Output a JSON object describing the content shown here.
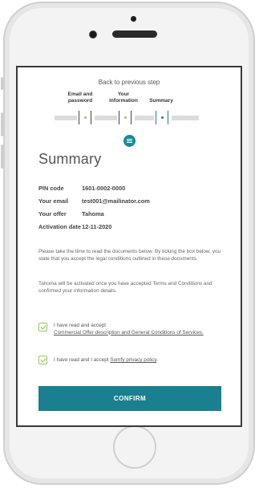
{
  "nav": {
    "back_label": "Back to previous step"
  },
  "steps": [
    {
      "line1": "Email and",
      "line2": "password",
      "status": "completed"
    },
    {
      "line1": "Your",
      "line2": "information",
      "status": "completed"
    },
    {
      "line1": "Summary",
      "line2": "",
      "status": "current"
    }
  ],
  "page": {
    "title": "Summary"
  },
  "summary": {
    "rows": [
      {
        "label": "PIN code",
        "value": "1601-0002-0000"
      },
      {
        "label": "Your email",
        "value": "test001@mailinator.com"
      },
      {
        "label": "Your offer",
        "value": "Tahoma"
      },
      {
        "label": "Activation date",
        "value": "12-11-2020"
      }
    ]
  },
  "text": {
    "para1": "Please take the time to read the documents below. By ticking the box below, you state that you accept the legal conditions outlined in these documents.",
    "para2": "Tahoma will be activated once you have accepted Terms and Conditions and confirmed your information details."
  },
  "checks": {
    "terms_prefix": "I have read and accept",
    "terms_link": "Commercial Offer description and General Conditions of Services.",
    "privacy_prefix": "I have read and I accept",
    "privacy_link": "Somfy privacy policy",
    "privacy_suffix": "."
  },
  "actions": {
    "confirm_label": "CONFIRM"
  },
  "colors": {
    "accent": "#1a7f8e",
    "check": "#9ec25a"
  }
}
